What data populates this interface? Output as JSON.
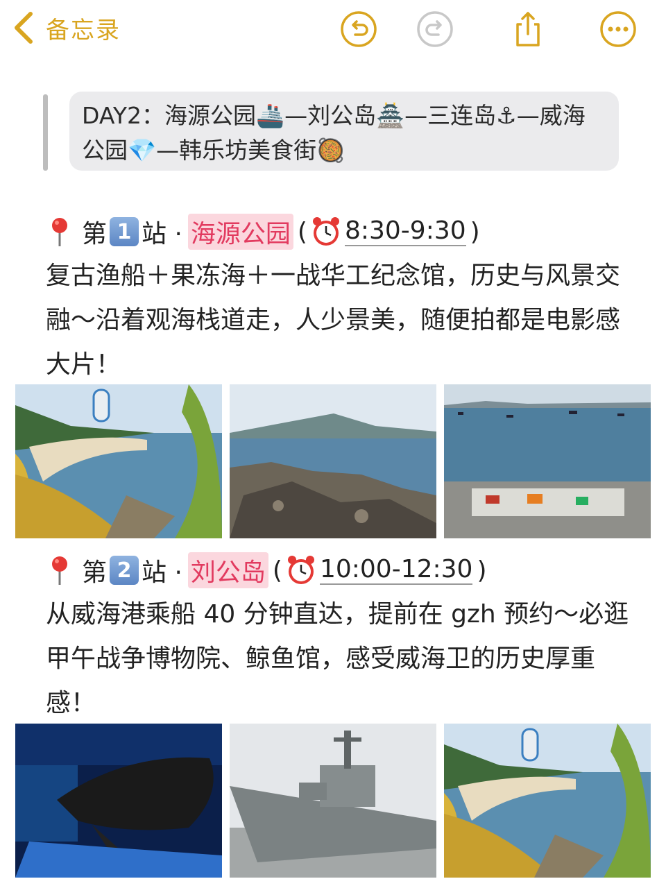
{
  "nav": {
    "back_label": "备忘录"
  },
  "summary": {
    "text": "DAY2：海源公园🚢—刘公岛🏯—三连岛⚓—威海公园💎—韩乐坊美食街🥘"
  },
  "stations": [
    {
      "prefix": "第",
      "number": "1",
      "suffix": "站 ·",
      "place": "海源公园",
      "open_paren": "(",
      "time": "8:30-9:30",
      "close_paren": ")",
      "description": "复古渔船＋果冻海＋一战华工纪念馆，历史与风景交融～沿着观海栈道走，人少景美，随便拍都是电影感大片！"
    },
    {
      "prefix": "第",
      "number": "2",
      "suffix": "站 ·",
      "place": "刘公岛",
      "open_paren": "(",
      "time": "10:00-12:30",
      "close_paren": ")",
      "description": "从威海港乘船 40 分钟直达，提前在 gzh 预约～必逛甲午战争博物院、鲸鱼馆，感受威海卫的历史厚重感！"
    }
  ],
  "icons": {
    "back": "chevron-left-icon",
    "undo": "undo-icon",
    "redo": "redo-icon",
    "share": "share-icon",
    "more": "more-icon"
  },
  "colors": {
    "accent": "#d9a520",
    "place_highlight": "#fbd7de",
    "place_text": "#e23a5f"
  }
}
